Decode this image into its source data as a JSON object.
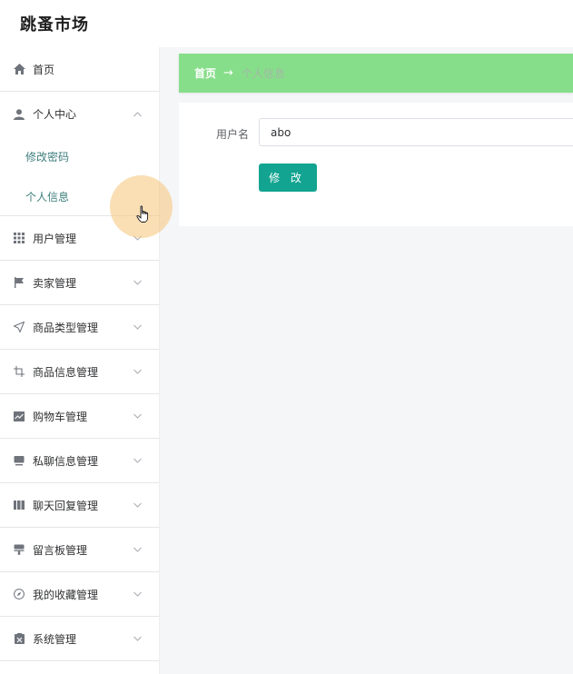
{
  "app": {
    "title": "跳蚤市场"
  },
  "sidebar": {
    "items": [
      {
        "label": "首页",
        "icon": "home-icon"
      },
      {
        "label": "个人中心",
        "icon": "user-icon",
        "expanded": true,
        "children": [
          {
            "label": "修改密码"
          },
          {
            "label": "个人信息"
          }
        ]
      },
      {
        "label": "用户管理",
        "icon": "grid-icon"
      },
      {
        "label": "卖家管理",
        "icon": "flag-icon"
      },
      {
        "label": "商品类型管理",
        "icon": "send-icon"
      },
      {
        "label": "商品信息管理",
        "icon": "crop-icon"
      },
      {
        "label": "购物车管理",
        "icon": "trend-chart-icon"
      },
      {
        "label": "私聊信息管理",
        "icon": "monitor-icon"
      },
      {
        "label": "聊天回复管理",
        "icon": "film-icon"
      },
      {
        "label": "留言板管理",
        "icon": "stamp-icon"
      },
      {
        "label": "我的收藏管理",
        "icon": "compass-icon"
      },
      {
        "label": "系统管理",
        "icon": "clipboard-icon"
      }
    ]
  },
  "breadcrumb": {
    "home": "首页",
    "separator": "→",
    "current": "个人信息"
  },
  "form": {
    "username_label": "用户名",
    "username_value": "abo",
    "submit_label": "修 改"
  },
  "colors": {
    "accent": "#12a490",
    "breadcrumb_bg": "#87de8a",
    "submenu_text": "#3f7f7d"
  }
}
